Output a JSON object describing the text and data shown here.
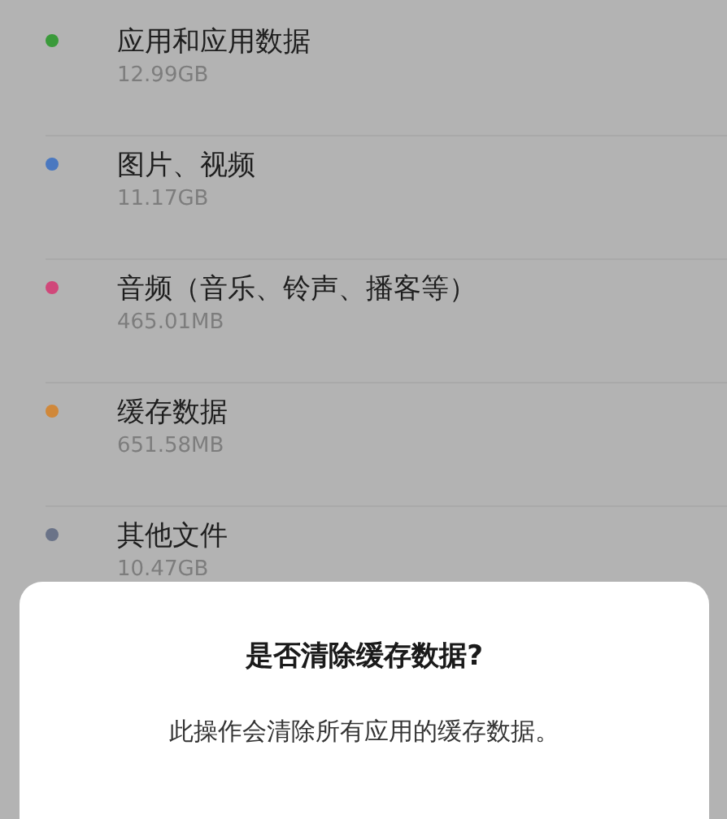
{
  "storage_items": [
    {
      "name": "应用和应用数据",
      "size": "12.99GB",
      "color": "#3a9a3a"
    },
    {
      "name": "图片、视频",
      "size": "11.17GB",
      "color": "#4a78c0"
    },
    {
      "name": "音频（音乐、铃声、播客等）",
      "size": "465.01MB",
      "color": "#d0487a"
    },
    {
      "name": "缓存数据",
      "size": "651.58MB",
      "color": "#d0883a"
    },
    {
      "name": "其他文件",
      "size": "10.47GB",
      "color": "#6a7388"
    }
  ],
  "dialog": {
    "title": "是否清除缓存数据?",
    "message": "此操作会清除所有应用的缓存数据。"
  }
}
